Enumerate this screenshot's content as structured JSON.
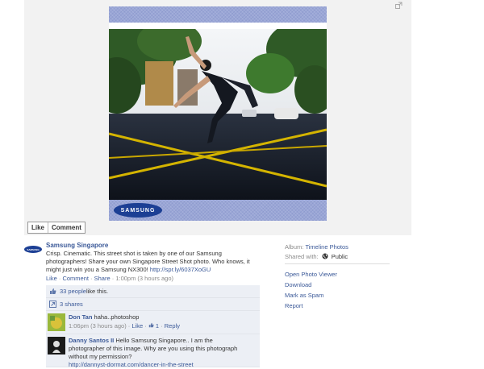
{
  "photo": {
    "brand_badge": "SAMSUNG",
    "actions": {
      "like": "Like",
      "comment": "Comment"
    }
  },
  "post": {
    "avatar_text": "SAMSUNG",
    "author": "Samsung Singapore",
    "text": "Crisp. Cinematic. This street shot is taken by one of our Samsung photographers! Share your own Singapore Street Shot photo. Who knows, it might just win you a Samsung NX300!",
    "link": "http://spr.ly/6037XoGU",
    "meta": {
      "like": "Like",
      "comment": "Comment",
      "share": "Share",
      "time": "1:00pm (3 hours ago)"
    }
  },
  "feed": {
    "likes_count": "33 people",
    "likes_suffix": " like this.",
    "shares": "3 shares",
    "comments": [
      {
        "name": "Don Tan",
        "text": "haha..photoshop",
        "time": "1:06pm (3 hours ago)",
        "like": "Like",
        "likes": "1",
        "reply": "Reply"
      },
      {
        "name": "Danny Santos II",
        "text": "Hello Samsung Singapore.. I am the photographer of this image. Why are you using this photograph without my permission?",
        "link": "http://dannyst-dormat.com/dancer-in-the-street"
      }
    ]
  },
  "sidebar": {
    "album_label": "Album:",
    "album_value": "Timeline Photos",
    "shared_label": "Shared with:",
    "shared_value": "Public",
    "links": [
      "Open Photo Viewer",
      "Download",
      "Mark as Spam",
      "Report"
    ]
  },
  "colors": {
    "fb_blue": "#3b5998",
    "samsung_blue": "#1c3f94",
    "feed_bg": "#eceff5"
  }
}
